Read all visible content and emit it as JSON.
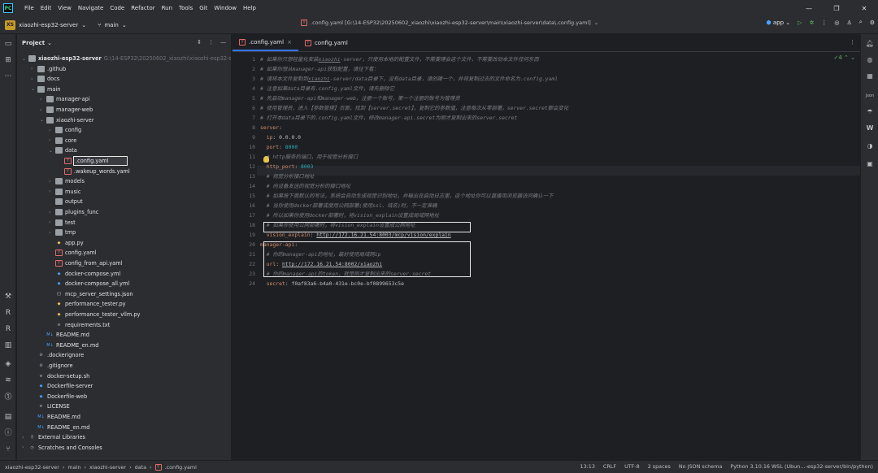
{
  "menu": [
    "File",
    "Edit",
    "View",
    "Navigate",
    "Code",
    "Refactor",
    "Run",
    "Tools",
    "Git",
    "Window",
    "Help"
  ],
  "toolbar": {
    "project_badge": "XS",
    "project_name": "xiaozhi-esp32-server",
    "branch": "main",
    "file_path": ".config.yaml [G:\\14-ESP32\\20250602_xiaozhi\\xiaozhi-esp32-server\\main\\xiaozhi-server\\data\\.config.yaml]",
    "run_config": "app"
  },
  "project_panel": {
    "title": "Project",
    "tree": [
      {
        "depth": 0,
        "arrow": "v",
        "icon": "folder",
        "label": "xiaozhi-esp32-server",
        "hint": "G:\\14-ESP32\\20250602_xiaozhi\\xiaozhi-esp32-server",
        "bold": true
      },
      {
        "depth": 1,
        "arrow": ">",
        "icon": "folder",
        "label": ".github"
      },
      {
        "depth": 1,
        "arrow": ">",
        "icon": "folder",
        "label": "docs"
      },
      {
        "depth": 1,
        "arrow": "v",
        "icon": "folder",
        "label": "main"
      },
      {
        "depth": 2,
        "arrow": ">",
        "icon": "folder",
        "label": "manager-api"
      },
      {
        "depth": 2,
        "arrow": ">",
        "icon": "folder",
        "label": "manager-web"
      },
      {
        "depth": 2,
        "arrow": "v",
        "icon": "folder",
        "label": "xiaozhi-server"
      },
      {
        "depth": 3,
        "arrow": ">",
        "icon": "folder",
        "label": "config"
      },
      {
        "depth": 3,
        "arrow": ">",
        "icon": "folder",
        "label": "core"
      },
      {
        "depth": 3,
        "arrow": "v",
        "icon": "folder",
        "label": "data"
      },
      {
        "depth": 4,
        "arrow": "",
        "icon": "yaml",
        "label": ".config.yaml",
        "selected": true
      },
      {
        "depth": 4,
        "arrow": "",
        "icon": "yaml",
        "label": ".wakeup_words.yaml"
      },
      {
        "depth": 3,
        "arrow": ">",
        "icon": "folder",
        "label": "models"
      },
      {
        "depth": 3,
        "arrow": ">",
        "icon": "folder",
        "label": "music"
      },
      {
        "depth": 3,
        "arrow": "",
        "icon": "folder",
        "label": "output"
      },
      {
        "depth": 3,
        "arrow": ">",
        "icon": "folder",
        "label": "plugins_func"
      },
      {
        "depth": 3,
        "arrow": ">",
        "icon": "folder",
        "label": "test"
      },
      {
        "depth": 3,
        "arrow": ">",
        "icon": "folder",
        "label": "tmp"
      },
      {
        "depth": 3,
        "arrow": "",
        "icon": "python",
        "label": "app.py"
      },
      {
        "depth": 3,
        "arrow": "",
        "icon": "yaml",
        "label": "config.yaml"
      },
      {
        "depth": 3,
        "arrow": "",
        "icon": "yaml",
        "label": "config_from_api.yaml"
      },
      {
        "depth": 3,
        "arrow": "",
        "icon": "docker",
        "label": "docker-compose.yml"
      },
      {
        "depth": 3,
        "arrow": "",
        "icon": "docker",
        "label": "docker-compose_all.yml"
      },
      {
        "depth": 3,
        "arrow": "",
        "icon": "json",
        "label": "mcp_server_settings.json"
      },
      {
        "depth": 3,
        "arrow": "",
        "icon": "python",
        "label": "performance_tester.py"
      },
      {
        "depth": 3,
        "arrow": "",
        "icon": "python",
        "label": "performance_tester_vllm.py"
      },
      {
        "depth": 3,
        "arrow": "",
        "icon": "text",
        "label": "requirements.txt"
      },
      {
        "depth": 2,
        "arrow": "",
        "icon": "md",
        "label": "README.md"
      },
      {
        "depth": 2,
        "arrow": "",
        "icon": "md",
        "label": "README_en.md"
      },
      {
        "depth": 1,
        "arrow": "",
        "icon": "ignore",
        "label": ".dockerignore"
      },
      {
        "depth": 1,
        "arrow": "",
        "icon": "ignore",
        "label": ".gitignore"
      },
      {
        "depth": 1,
        "arrow": "",
        "icon": "text",
        "label": "docker-setup.sh"
      },
      {
        "depth": 1,
        "arrow": "",
        "icon": "docker",
        "label": "Dockerfile-server"
      },
      {
        "depth": 1,
        "arrow": "",
        "icon": "docker",
        "label": "Dockerfile-web"
      },
      {
        "depth": 1,
        "arrow": "",
        "icon": "text",
        "label": "LICENSE"
      },
      {
        "depth": 1,
        "arrow": "",
        "icon": "md",
        "label": "README.md"
      },
      {
        "depth": 1,
        "arrow": "",
        "icon": "md",
        "label": "README_en.md"
      },
      {
        "depth": 0,
        "arrow": ">",
        "icon": "library",
        "label": "External Libraries"
      },
      {
        "depth": 0,
        "arrow": ">",
        "icon": "scratch",
        "label": "Scratches and Consoles"
      }
    ]
  },
  "tabs": [
    {
      "label": ".config.yaml",
      "active": true,
      "close": "×"
    },
    {
      "label": "config.yaml",
      "active": false,
      "close": ""
    }
  ],
  "inspection": "✓4",
  "code": [
    {
      "n": "1",
      "parts": [
        [
          "cm",
          "# 如果你只想轻量化安装"
        ],
        [
          "cm ul",
          "xiaozhi"
        ],
        [
          "cm",
          "-server，只使用本地的配置文件，不需要理会这个文件，不需要改动本文件任何东西"
        ]
      ]
    },
    {
      "n": "2",
      "parts": [
        [
          "cm",
          "# 如果你想从manager-api获取配置，请往下看："
        ]
      ]
    },
    {
      "n": "3",
      "parts": [
        [
          "cm",
          "# 请将本文件复制到"
        ],
        [
          "cm ul",
          "xiaozhi"
        ],
        [
          "cm",
          "-server/data目录下，没有data目录，请创建一个，并将复制过去的文件命名为.config.yaml"
        ]
      ]
    },
    {
      "n": "4",
      "parts": [
        [
          "cm",
          "# 注意如果data目录有.config.yaml文件，请先删除它"
        ]
      ]
    },
    {
      "n": "5",
      "parts": [
        [
          "cm",
          "# 先启动manager-api和manager-web，注册一个账号，第一个注册的账号为管理员"
        ]
      ]
    },
    {
      "n": "6",
      "parts": [
        [
          "cm",
          "# 使用管理员，进入【参数管理】页面，找到【server.secret】，复制它的参数值，注意每次从零部署，server.secret都会变化"
        ]
      ]
    },
    {
      "n": "7",
      "parts": [
        [
          "cm",
          "# 打开本data目录下的.config.yaml文件，修改manager-api.secret为刚才复制出来的server.secret"
        ]
      ]
    },
    {
      "n": "8",
      "parts": [
        [
          "ky",
          "server"
        ],
        [
          "vl",
          ":"
        ]
      ]
    },
    {
      "n": "9",
      "parts": [
        [
          "ky",
          "  ip"
        ],
        [
          "vl",
          ": 0.0.0.0"
        ]
      ]
    },
    {
      "n": "10",
      "parts": [
        [
          "ky",
          "  port"
        ],
        [
          "vl",
          ": "
        ],
        [
          "nm",
          "8000"
        ]
      ]
    },
    {
      "n": "11",
      "parts": [
        [
          "cm",
          "  # http服务的端口，用于视觉分析接口"
        ]
      ]
    },
    {
      "n": "12",
      "parts": [
        [
          "ky",
          "  http_port"
        ],
        [
          "vl",
          ": "
        ],
        [
          "nm",
          "8003"
        ]
      ]
    },
    {
      "n": "13",
      "parts": [
        [
          "cm",
          "  # 视觉分析接口地址"
        ]
      ]
    },
    {
      "n": "14",
      "parts": [
        [
          "cm",
          "  # 向设备发送的视觉分析的接口地址"
        ]
      ]
    },
    {
      "n": "15",
      "parts": [
        [
          "cm",
          "  # 如果按下面默认的写法，系统会自动生成视觉识别地址，并输出在启动日志里，这个地址你可以直接用浏览器访问确认一下"
        ]
      ]
    },
    {
      "n": "16",
      "parts": [
        [
          "cm",
          "  # 当你使用docker部署或使用公网部署(使用ssl、域名)时，不一定准确"
        ]
      ]
    },
    {
      "n": "17",
      "parts": [
        [
          "cm",
          "  # 所以如果你使用docker部署时，将vision_explain设置成局域网地址"
        ]
      ]
    },
    {
      "n": "18",
      "parts": [
        [
          "cm",
          "  # 如果你使用公网部署时，将vision_explain设置成公网地址"
        ]
      ]
    },
    {
      "n": "19",
      "parts": [
        [
          "ky",
          "  vision_explain"
        ],
        [
          "vl",
          ": "
        ],
        [
          "vl ul",
          "http://172.16.21.54:8003/mcp/vision/explain"
        ]
      ]
    },
    {
      "n": "20",
      "parts": [
        [
          "ky",
          "manager-api"
        ],
        [
          "vl",
          ":"
        ]
      ]
    },
    {
      "n": "21",
      "parts": [
        [
          "cm",
          "  # 你的manager-api的地址，最好使用局域网ip"
        ]
      ]
    },
    {
      "n": "22",
      "parts": [
        [
          "ky",
          "  url"
        ],
        [
          "vl",
          ": "
        ],
        [
          "vl ul",
          "http://172.16.21.54:8002/xiaozhi"
        ]
      ]
    },
    {
      "n": "23",
      "parts": [
        [
          "cm",
          "  # 你的manager-api的token，就是刚才复制出来的server.secret"
        ]
      ]
    },
    {
      "n": "24",
      "parts": [
        [
          "ky",
          "  secret"
        ],
        [
          "vl",
          ": f0af83a6-b4a0-431e-bc0e-bf0899653c5e"
        ]
      ]
    }
  ],
  "statusbar": {
    "breadcrumbs": [
      "xiaozhi-esp32-server",
      "main",
      "xiaozhi-server",
      "data",
      ".config.yaml"
    ],
    "right": [
      "13:13",
      "CRLF",
      "UTF-8",
      "2 spaces",
      "No JSON schema",
      "Python 3.10.16 WSL (Ubun…-esp32-server/bin/python)"
    ]
  }
}
